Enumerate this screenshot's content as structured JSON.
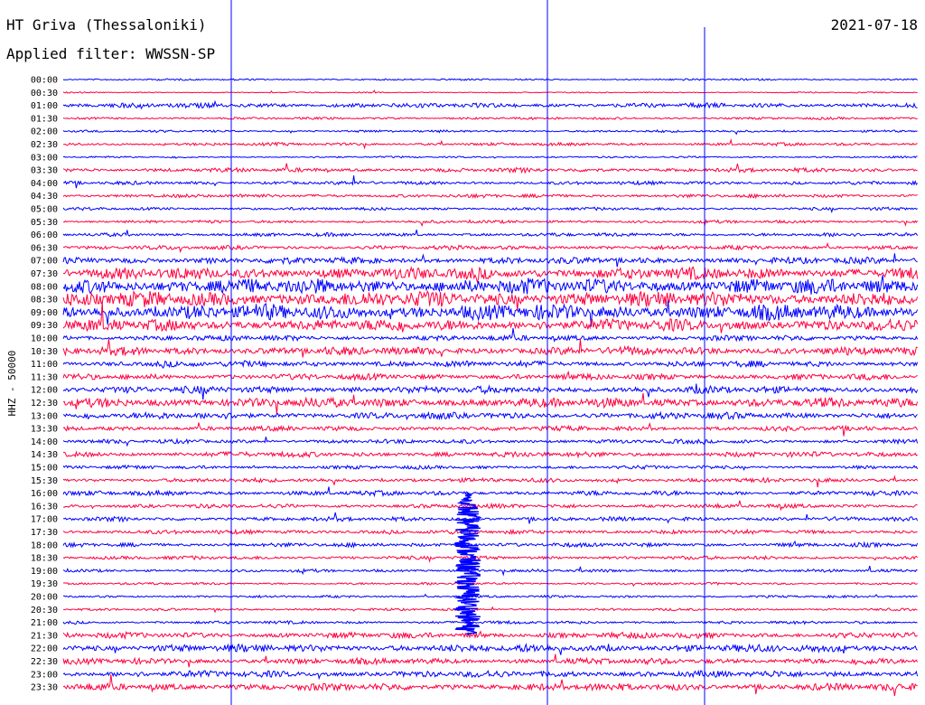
{
  "header": {
    "station": "HT Griva (Thessaloniki)",
    "date": "2021-07-18",
    "filter": "Applied filter: WWSSN-SP"
  },
  "chart_data": {
    "type": "line",
    "title": "HT Griva (Thessaloniki)",
    "subtitle": "Applied filter: WWSSN-SP",
    "date": "2021-07-18",
    "ylabel": "HHZ - 50000",
    "xlabel": "",
    "grid": false,
    "trace_colors": [
      "#0000ff",
      "#ff0040"
    ],
    "row_labels": [
      "00:00",
      "00:30",
      "01:00",
      "01:30",
      "02:00",
      "02:30",
      "03:00",
      "03:30",
      "04:00",
      "04:30",
      "05:00",
      "05:30",
      "06:00",
      "06:30",
      "07:00",
      "07:30",
      "08:00",
      "08:30",
      "09:00",
      "09:30",
      "10:00",
      "10:30",
      "11:00",
      "11:30",
      "12:00",
      "12:30",
      "13:00",
      "13:30",
      "14:00",
      "14:30",
      "15:00",
      "15:30",
      "16:00",
      "16:30",
      "17:00",
      "17:30",
      "18:00",
      "18:30",
      "19:00",
      "19:30",
      "20:00",
      "20:30",
      "21:00",
      "21:30",
      "22:00",
      "22:30",
      "23:00",
      "23:30"
    ],
    "row_noise_level": [
      0.3,
      0.2,
      0.8,
      0.4,
      0.4,
      0.5,
      0.3,
      0.7,
      0.6,
      0.6,
      0.5,
      0.5,
      0.6,
      0.7,
      1.1,
      2.0,
      2.6,
      2.6,
      2.6,
      2.0,
      0.9,
      1.4,
      1.0,
      1.0,
      1.2,
      1.6,
      1.1,
      0.8,
      0.7,
      0.9,
      0.6,
      0.7,
      0.8,
      0.7,
      0.7,
      0.7,
      0.7,
      0.6,
      0.5,
      0.4,
      0.4,
      0.4,
      0.5,
      1.0,
      1.3,
      1.0,
      1.1,
      1.2
    ],
    "events": [
      {
        "row": 32,
        "minute": 14.2,
        "amplitude": 9.0,
        "duration_rows": 11,
        "note": "large arrival spanning many rows"
      }
    ]
  }
}
